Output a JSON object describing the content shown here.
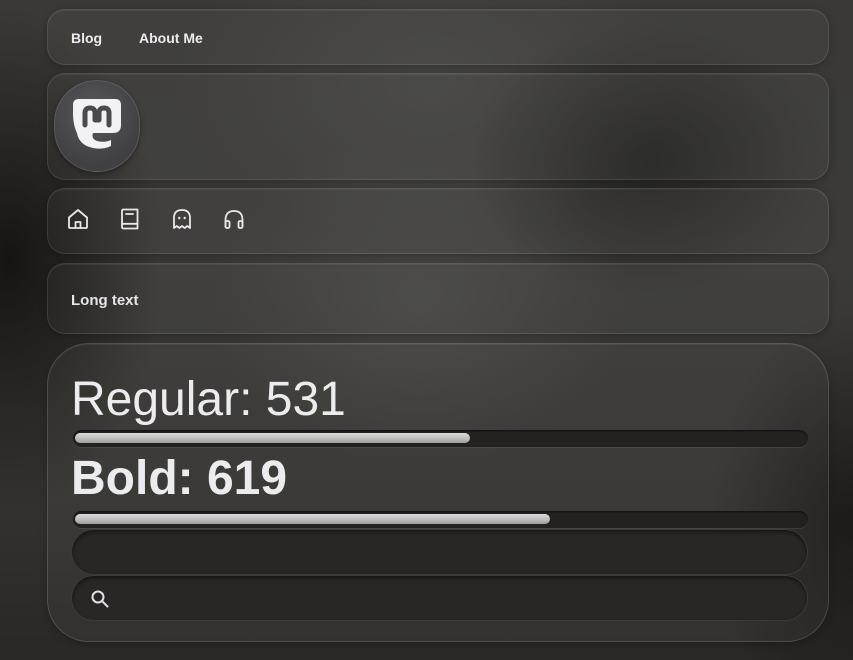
{
  "nav": {
    "links": [
      {
        "label": "Blog"
      },
      {
        "label": "About Me"
      }
    ]
  },
  "profile": {
    "avatar_icon": "mastodon-logo-icon"
  },
  "icon_row": {
    "icons": [
      "home-icon",
      "book-icon",
      "ghost-icon",
      "headphones-icon"
    ]
  },
  "long_text": {
    "label": "Long text"
  },
  "stats": {
    "regular": {
      "label": "Regular: 531",
      "progress_fraction": 0.54
    },
    "bold": {
      "label": "Bold: 619",
      "progress_fraction": 0.65
    }
  },
  "text_input": {
    "value": "",
    "placeholder": ""
  },
  "search": {
    "icon": "search-icon",
    "value": "",
    "placeholder": ""
  },
  "colors": {
    "text": "#ececef",
    "progress_fill": "#c8c7c4",
    "progress_track": "#232221",
    "field_bg": "#282725"
  }
}
